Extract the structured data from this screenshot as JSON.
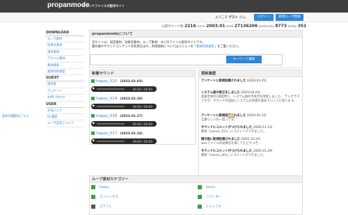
{
  "header": {
    "logo": "propanmode",
    "tagline": "サウンドファイルの配布サイト"
  },
  "userbar": {
    "greeting_prefix": "ようこそ",
    "user": "ゲスト",
    "greeting_suffix": "さん。",
    "login": "ログイン",
    "register": "新規ユーザ登録"
  },
  "stats": {
    "l1": "公開サウンド数",
    "v1": "2216",
    "l2": "since",
    "v2": "2003.01",
    "l3": "total",
    "v3": "27136206",
    "l4": "yesterday",
    "v4": "8773",
    "l5": "today",
    "v5": "351"
  },
  "sidebar": {
    "download_title": "DOWNLOAD",
    "download": [
      "ループ素材",
      "効果音素材",
      "顔音素材",
      "アルバム素材",
      "素材検索",
      "素材利用規定"
    ],
    "guest_title": "GUEST",
    "guest": [
      "掲示板",
      "アンケート",
      "お問い合わせ"
    ],
    "user_title": "USER",
    "user": [
      "お気に入り",
      "DL履歴",
      "ユーザ設定について"
    ]
  },
  "about": {
    "title": "propanmodeについて",
    "line1": "当サイトは、固定素材、効果音素材、ループ素材、などのファイル配布サイトです。",
    "line2_pre": "著作権やサウンドコンテンツを利用方法や、利用規約についてはメニューの「",
    "line2_link": "素材利用規定",
    "line2_post": "」をご覧ください。"
  },
  "search": {
    "placeholder": "",
    "button": "キーワード検索"
  },
  "new_sounds": {
    "title": "新着サウンド",
    "items": [
      {
        "name": "happy_020",
        "date": "(2023.02.03)",
        "time": "00:00 / 00:00"
      },
      {
        "name": "happy_019",
        "date": "(2023.01.30)",
        "time": "00:00 / 00:00"
      },
      {
        "name": "happy_018",
        "date": "(2023.01.27)",
        "time": "00:00 / 00:00"
      },
      {
        "name": "happy_017",
        "date": "(2023.01.24)",
        "time": "00:00 / 00:00"
      }
    ]
  },
  "updates": {
    "title": "更新履歴",
    "items": [
      {
        "head": "アンケートに新規投稿されました",
        "date": "(2023.03.25)",
        "body": ""
      },
      {
        "head": "システム面の修正をしました",
        "date": "(2023.02.03)",
        "body": "高速全体の1部変更と、システム面の不具合を改善しました。 テレグラマですが、サウンドの追加とシステムの改善を進めていこうと思います。"
      },
      {
        "head": "アンケートに新規投稿されました",
        "date": "(2023.01.12)",
        "body": "言葉らしいの一度ってる。"
      },
      {
        "head": "サウンドにコメントがつけられました",
        "date": "(2022.11.13)",
        "body": "素材「pianoL_011」にコメントがつきました。"
      },
      {
        "head": "掲示板に新規投稿されました",
        "date": "(2021.10.25)",
        "body": "wavファイルの効果音を探してたどりつき…"
      },
      {
        "head": "サウンドにコメントがつけられました",
        "date": "(2021.01.29)",
        "body": "素材「pianoL_001」にコメントがつきました。"
      }
    ],
    "link": "過去の履歴はこちら",
    "tag": "RSS"
  },
  "loops": {
    "title": "ループ素材カテゴリー",
    "items": [
      "happy",
      "bossa",
      "ストリングス",
      "リコーダー",
      "ピアノ3",
      "シャッフル"
    ]
  },
  "colors": {
    "topbar": "#3e3e3e",
    "accent": "#2f86d7",
    "green": "#3aa44a"
  }
}
